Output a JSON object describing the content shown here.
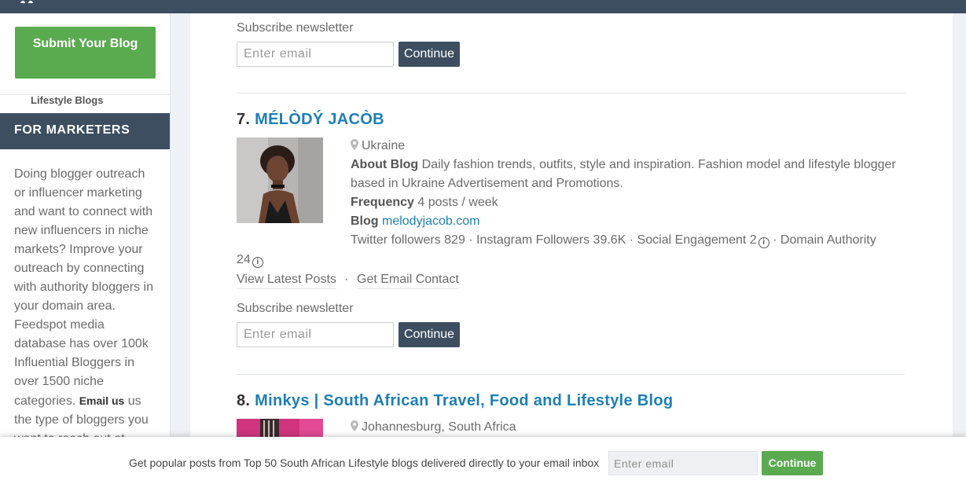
{
  "sidebar": {
    "submit_label": "Submit Your Blog",
    "category_link": "Lifestyle Blogs",
    "marketers_heading": "FOR MARKETERS",
    "marketers_text_1": "Doing blogger outreach or influencer marketing and want to connect with new influencers in niche markets? Improve your outreach by connecting with authority bloggers in your domain area. Feedspot media database has over 100k Influential Bloggers in over 1500 niche categories.",
    "marketers_email": "Email us",
    "marketers_text_2": "us the type of bloggers you want to reach out at"
  },
  "subscribe": {
    "label": "Subscribe newsletter",
    "placeholder": "Enter email",
    "button": "Continue"
  },
  "entries": [
    {
      "number": "7.",
      "title": "MÉLÒDÝ JACÒB",
      "location": "Ukraine",
      "about_label": "About Blog",
      "about": "Daily fashion trends, outfits, style and inspiration. Fashion model and lifestyle blogger based in Ukraine Advertisement and Promotions.",
      "frequency_label": "Frequency",
      "frequency": "4 posts / week",
      "blog_label": "Blog",
      "blog_url": "melodyjacob.com",
      "stats_line": "Twitter followers 829 · Instagram Followers 39.6K · Social Engagement 2",
      "stats_tail": "· Domain Authority",
      "domain_authority": "24",
      "view_posts": "View Latest Posts",
      "separator": "·",
      "email_contact": "Get Email Contact"
    },
    {
      "number": "8.",
      "title": "Minkys | South African Travel, Food and Lifestyle Blog",
      "location": "Johannesburg, South Africa"
    }
  ],
  "bottombar": {
    "text": "Get popular posts from Top 50 South African Lifestyle blogs delivered directly to your email inbox",
    "placeholder": "Enter email",
    "button": "Continue"
  },
  "colors": {
    "header_bg": "#3d4e61",
    "green": "#5aab4f",
    "link_blue": "#1e7fb6"
  }
}
